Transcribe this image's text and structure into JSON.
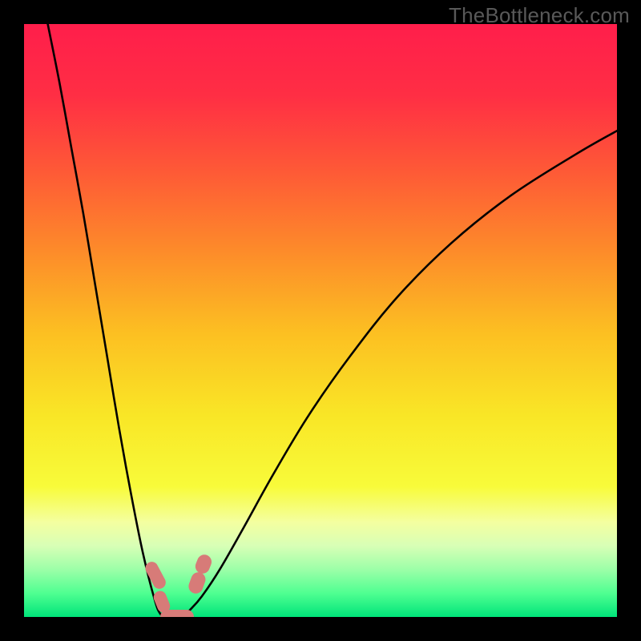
{
  "watermark": "TheBottleneck.com",
  "colors": {
    "frame": "#000000",
    "curve": "#000000",
    "blob": "#d77b78"
  },
  "chart_data": {
    "type": "line",
    "title": "",
    "xlabel": "",
    "ylabel": "",
    "xlim": [
      0,
      100
    ],
    "ylim": [
      0,
      100
    ],
    "gradient_stops": [
      {
        "offset": 0.0,
        "color": "#ff1e4b"
      },
      {
        "offset": 0.12,
        "color": "#ff2e44"
      },
      {
        "offset": 0.25,
        "color": "#fe5a36"
      },
      {
        "offset": 0.38,
        "color": "#fd8a2a"
      },
      {
        "offset": 0.52,
        "color": "#fcbf22"
      },
      {
        "offset": 0.66,
        "color": "#f9e626"
      },
      {
        "offset": 0.78,
        "color": "#f8fb3a"
      },
      {
        "offset": 0.84,
        "color": "#f4ffa0"
      },
      {
        "offset": 0.88,
        "color": "#d8ffb6"
      },
      {
        "offset": 0.92,
        "color": "#9cffa8"
      },
      {
        "offset": 0.96,
        "color": "#4fff91"
      },
      {
        "offset": 1.0,
        "color": "#00e47a"
      }
    ],
    "series": [
      {
        "name": "bottleneck-curve-left",
        "x": [
          4,
          6,
          8,
          10,
          12,
          14,
          16,
          18,
          20,
          22,
          23,
          24
        ],
        "y": [
          100,
          90,
          79,
          68,
          56,
          44,
          32,
          21,
          11,
          3,
          0.5,
          0
        ]
      },
      {
        "name": "bottleneck-curve-right",
        "x": [
          26,
          27,
          28,
          30,
          33,
          37,
          42,
          48,
          55,
          63,
          72,
          82,
          93,
          100
        ],
        "y": [
          0,
          0.4,
          1.2,
          3.5,
          8,
          15,
          24,
          34,
          44,
          54,
          63,
          71,
          78,
          82
        ]
      }
    ],
    "markers": [
      {
        "name": "blob-left-upper",
        "x": 22.2,
        "y": 7.0,
        "w": 2.2,
        "h": 4.8,
        "rotate": -28
      },
      {
        "name": "blob-left-lower",
        "x": 23.2,
        "y": 2.6,
        "w": 2.2,
        "h": 3.8,
        "rotate": -22
      },
      {
        "name": "blob-bottom",
        "x": 25.8,
        "y": 0.0,
        "w": 5.6,
        "h": 2.4,
        "rotate": 0
      },
      {
        "name": "blob-right-lower",
        "x": 29.2,
        "y": 5.8,
        "w": 2.4,
        "h": 3.6,
        "rotate": 20
      },
      {
        "name": "blob-right-upper",
        "x": 30.2,
        "y": 9.0,
        "w": 2.4,
        "h": 3.2,
        "rotate": 22
      }
    ]
  }
}
